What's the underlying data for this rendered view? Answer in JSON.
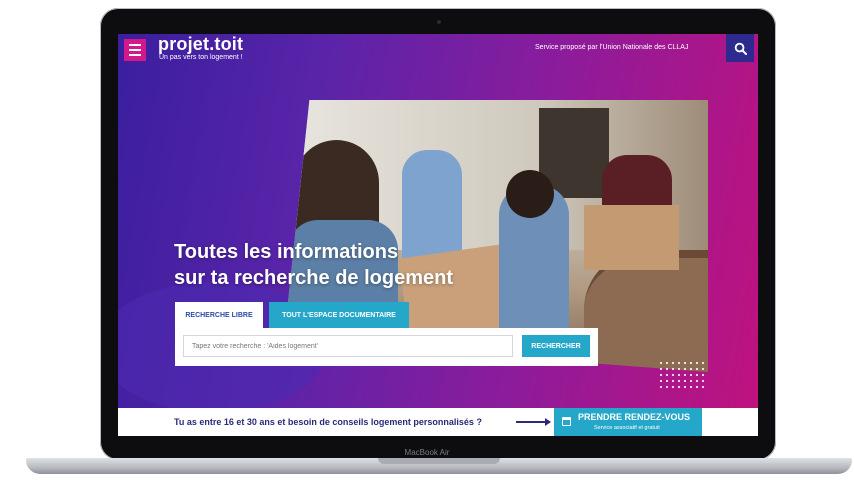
{
  "device": {
    "model_label": "MacBook Air"
  },
  "header": {
    "logo": "projet.toit",
    "tagline": "Un pas vers ton logement !",
    "service": "Service proposé par l'Union Nationale des CLLAJ"
  },
  "hero": {
    "headline_line1": "Toutes les informations",
    "headline_line2": "sur ta recherche de logement"
  },
  "tabs": [
    {
      "label": "RECHERCHE LIBRE",
      "active": true
    },
    {
      "label": "TOUT L'ESPACE DOCUMENTAIRE",
      "active": false
    }
  ],
  "search": {
    "placeholder": "Tapez votre recherche : 'Aides logement'",
    "value": "",
    "button_label": "RECHERCHER"
  },
  "cta": {
    "text": "Tu as entre 16 et 30 ans et besoin de conseils logement personnalisés ?",
    "button_label": "PRENDRE RENDEZ-VOUS",
    "button_sub": "Service associatif et gratuit"
  },
  "colors": {
    "accent_cyan": "#25a7c9",
    "accent_pink": "#d4178a",
    "navy": "#2a2a7a"
  },
  "icons": [
    "menu-icon",
    "search-icon",
    "calendar-icon",
    "arrow-right-icon"
  ]
}
